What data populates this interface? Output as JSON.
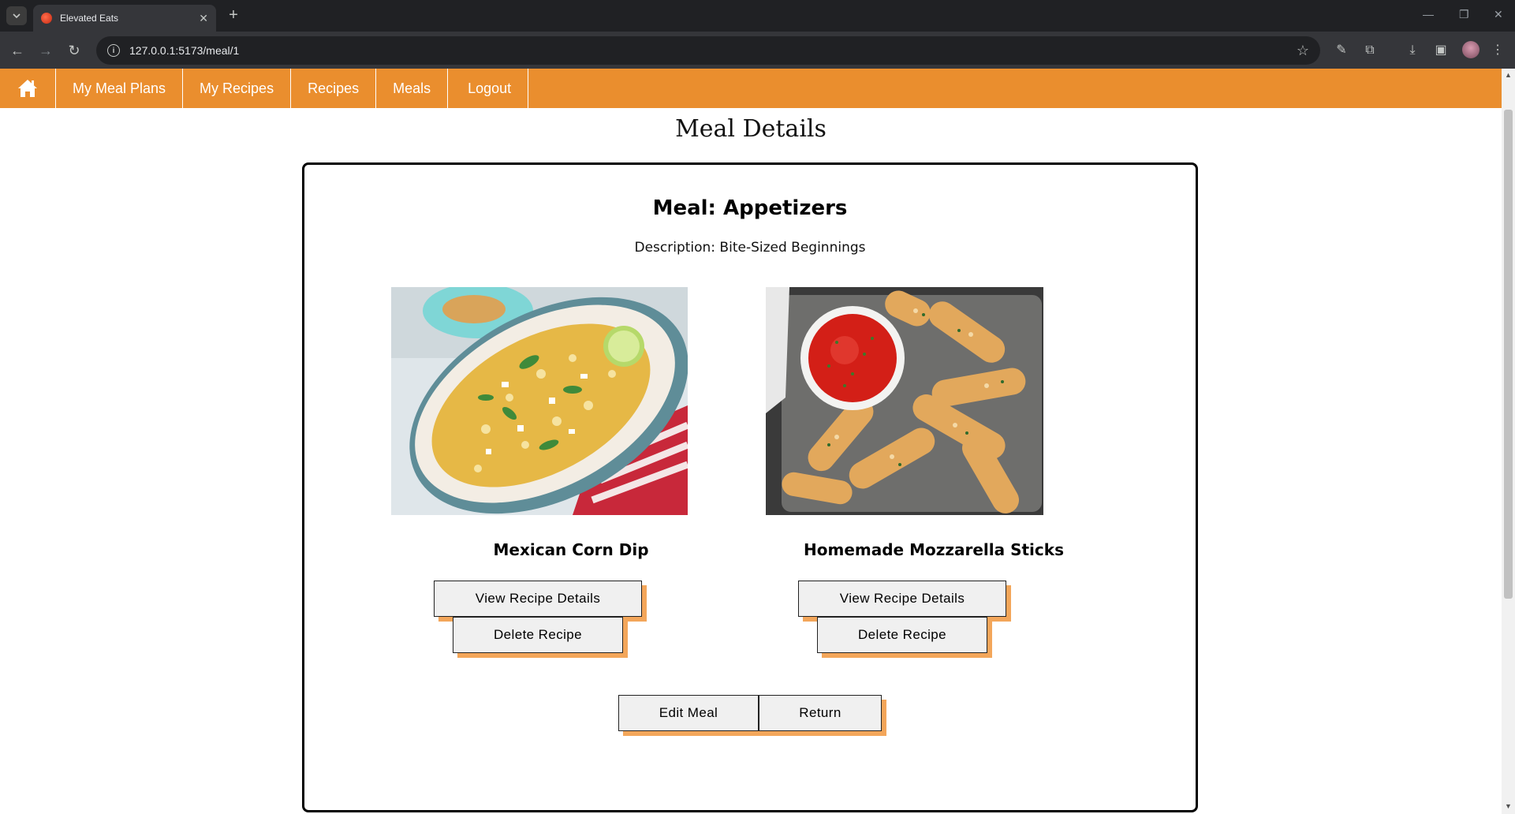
{
  "browser": {
    "tab_title": "Elevated Eats",
    "url": "127.0.0.1:5173/meal/1"
  },
  "nav": {
    "items": [
      {
        "label": "My Meal Plans"
      },
      {
        "label": "My Recipes"
      },
      {
        "label": "Recipes"
      },
      {
        "label": "Meals"
      },
      {
        "label": "Logout"
      }
    ]
  },
  "page": {
    "title": "Meal Details"
  },
  "meal": {
    "title": "Meal: Appetizers",
    "description": "Description: Bite-Sized Beginnings",
    "recipes": [
      {
        "name": "Mexican Corn Dip",
        "view_label": "View Recipe Details",
        "delete_label": "Delete Recipe"
      },
      {
        "name": "Homemade Mozzarella Sticks",
        "view_label": "View Recipe Details",
        "delete_label": "Delete Recipe"
      }
    ],
    "edit_label": "Edit Meal",
    "return_label": "Return"
  },
  "colors": {
    "nav_bg": "#ea8e2e",
    "button_shadow": "#f3a65a",
    "button_bg": "#f0f0f0"
  }
}
